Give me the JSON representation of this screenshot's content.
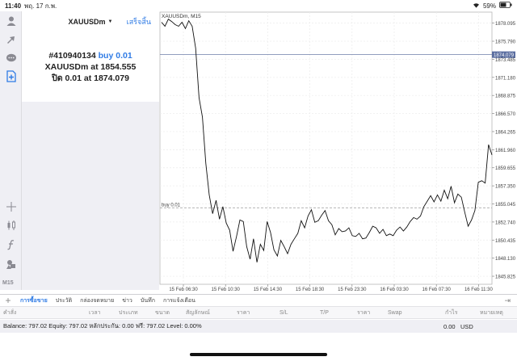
{
  "status_bar": {
    "time": "11:40",
    "date": "พฤ. 17 ก.พ.",
    "battery": "59%"
  },
  "panel": {
    "symbol": "XAUUSDm",
    "done_label": "เสร็จสิ้น",
    "order_line1_id": "#410940134",
    "order_line1_side": "buy 0.01",
    "order_line2_prefix": "XAUUSDm at",
    "order_line2_price": "1854.555",
    "order_line3_prefix": "ปิด 0.01 at",
    "order_line3_price": "1874.079"
  },
  "toolbar": {
    "icons": [
      "user-icon",
      "login-icon",
      "chat-icon",
      "new-order-icon",
      "crosshair-icon",
      "candles-icon",
      "function-icon",
      "objects-icon"
    ],
    "timeframe": "M15"
  },
  "chart_data": {
    "type": "line",
    "title": "XAUUSDm, M15",
    "y_ticks": [
      "1878.095",
      "1875.790",
      "1873.485",
      "1871.180",
      "1868.875",
      "1866.570",
      "1864.265",
      "1861.960",
      "1859.655",
      "1857.350",
      "1855.045",
      "1852.740",
      "1850.435",
      "1848.130",
      "1845.825"
    ],
    "x_ticks": [
      "15 Feb 06:30",
      "15 Feb 10:30",
      "15 Feb 14:30",
      "15 Feb 18:30",
      "15 Feb 23:30",
      "16 Feb 03:30",
      "16 Feb 07:30",
      "16 Feb 11:30"
    ],
    "ylim": [
      1844.8,
      1879.5
    ],
    "current_price_label": "1874.079",
    "current_price": 1874.079,
    "buy_level_label": "buy 0.01",
    "buy_level": 1854.555,
    "grid": true,
    "series": [
      {
        "values": [
          1878.2,
          1877.7,
          1878.6,
          1878.3,
          1877.9,
          1877.7,
          1878.2,
          1877.4,
          1878.4,
          1877.7,
          1874.9,
          1868.6,
          1866.1,
          1860.2,
          1856.2,
          1853.8,
          1855.5,
          1853.1,
          1854.7,
          1852.6,
          1851.7,
          1849.0,
          1850.9,
          1853.0,
          1852.8,
          1849.6,
          1848.0,
          1850.6,
          1847.6,
          1849.9,
          1849.1,
          1852.8,
          1851.4,
          1849.2,
          1848.4,
          1850.4,
          1849.6,
          1848.7,
          1849.9,
          1850.6,
          1851.3,
          1852.9,
          1852.0,
          1853.5,
          1854.3,
          1852.7,
          1852.9,
          1853.6,
          1854.2,
          1852.9,
          1852.4,
          1851.1,
          1851.9,
          1851.5,
          1851.6,
          1852.0,
          1851.0,
          1850.9,
          1851.3,
          1850.6,
          1850.7,
          1851.4,
          1852.2,
          1852.0,
          1851.3,
          1851.8,
          1851.0,
          1851.2,
          1851.0,
          1851.7,
          1852.1,
          1851.6,
          1852.1,
          1852.8,
          1853.3,
          1853.1,
          1853.5,
          1854.7,
          1855.4,
          1856.1,
          1855.3,
          1856.2,
          1855.4,
          1856.8,
          1855.7,
          1857.3,
          1855.2,
          1856.3,
          1855.9,
          1854.0,
          1852.2,
          1853.0,
          1854.2,
          1857.8,
          1858.0,
          1857.7,
          1862.6,
          1861.3
        ]
      }
    ]
  },
  "bottom_tabs": {
    "items": [
      "การซื้อขาย",
      "ประวัติ",
      "กล่องจดหมาย",
      "ข่าว",
      "บันทึก",
      "การแจ้งเตือน"
    ],
    "active": 0
  },
  "table_columns": [
    "คำสั่ง",
    "เวลา",
    "ประเภท",
    "ขนาด",
    "สัญลักษณ์",
    "ราคา",
    "S/L",
    "T/P",
    "ราคา",
    "Swap",
    "กำไร",
    "หมายเหตุ"
  ],
  "balance_bar": {
    "text": "Balance: 797.02 Equity: 797.02 หลักประกัน: 0.00 ฟรี: 797.02 Level: 0.00%",
    "profit": "0.00",
    "currency": "USD"
  }
}
